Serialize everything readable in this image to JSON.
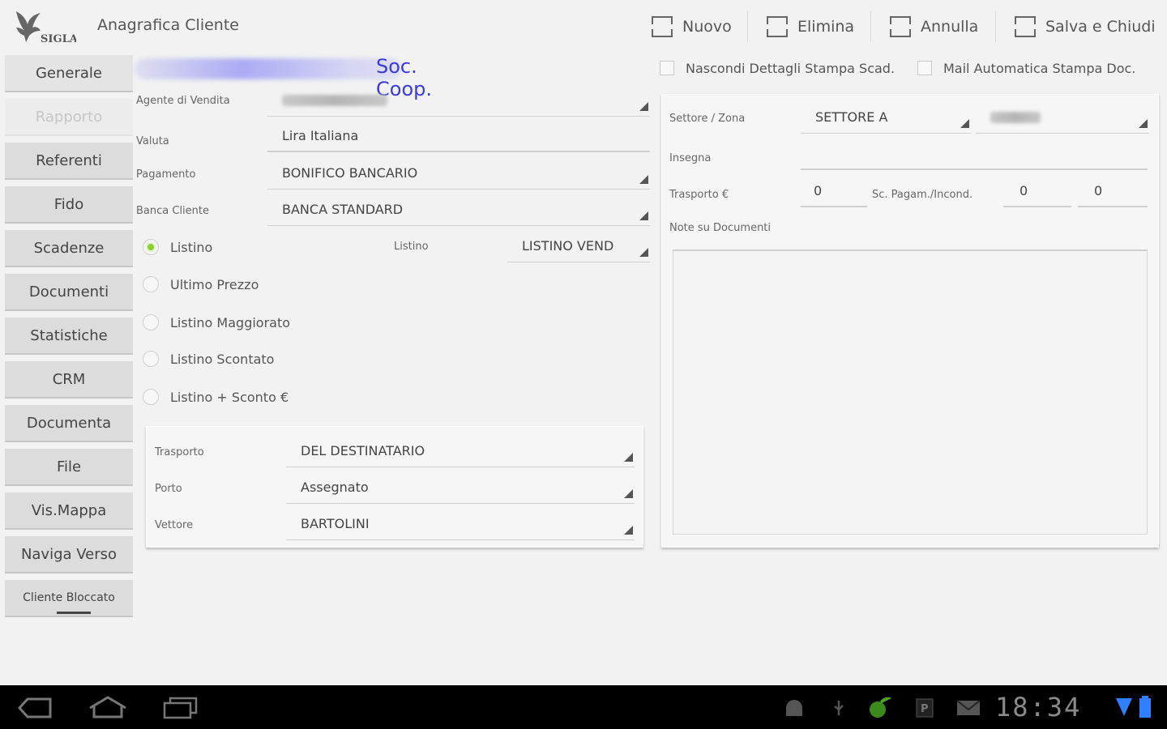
{
  "actionbar": {
    "title": "Anagrafica Cliente",
    "actions": [
      {
        "label": "Nuovo"
      },
      {
        "label": "Elimina"
      },
      {
        "label": "Annulla"
      },
      {
        "label": "Salva e Chiudi"
      }
    ]
  },
  "sidebar": {
    "items": [
      {
        "label": "Generale",
        "state": "selected"
      },
      {
        "label": "Rapporto",
        "state": "disabled"
      },
      {
        "label": "Referenti"
      },
      {
        "label": "Fido"
      },
      {
        "label": "Scadenze"
      },
      {
        "label": "Documenti"
      },
      {
        "label": "Statistiche"
      },
      {
        "label": "CRM"
      },
      {
        "label": "Documenta"
      },
      {
        "label": "File"
      },
      {
        "label": "Vis.Mappa"
      },
      {
        "label": "Naviga Verso"
      },
      {
        "label": "Cliente Bloccato"
      }
    ]
  },
  "client": {
    "name_suffix": "Soc. Coop."
  },
  "options": {
    "hide_print_details": {
      "label": "Nascondi Dettagli Stampa Scad.",
      "checked": false
    },
    "auto_mail": {
      "label": "Mail Automatica Stampa Doc.",
      "checked": false
    }
  },
  "left_form": {
    "agent": {
      "label": "Agente di Vendita",
      "value": "CUOMO EMILIO"
    },
    "currency": {
      "label": "Valuta",
      "value": "Lira Italiana"
    },
    "payment": {
      "label": "Pagamento",
      "value": "BONIFICO BANCARIO"
    },
    "bank": {
      "label": "Banca Cliente",
      "value": "BANCA STANDARD"
    },
    "pricing": {
      "options": [
        {
          "label": "Listino",
          "selected": true
        },
        {
          "label": "Ultimo Prezzo",
          "selected": false
        },
        {
          "label": "Listino Maggiorato",
          "selected": false
        },
        {
          "label": "Listino Scontato",
          "selected": false
        },
        {
          "label": "Listino + Sconto €",
          "selected": false
        }
      ],
      "list_label": "Listino",
      "list_value": "LISTINO VEND"
    }
  },
  "shipping": {
    "transport": {
      "label": "Trasporto",
      "value": "DEL DESTINATARIO"
    },
    "port": {
      "label": "Porto",
      "value": "Assegnato"
    },
    "carrier": {
      "label": "Vettore",
      "value": "BARTOLINI"
    }
  },
  "right_form": {
    "sector": {
      "label": "Settore / Zona",
      "value": "SETTORE A",
      "zone_value": "VARI"
    },
    "sign": {
      "label": "Insegna",
      "value": ""
    },
    "transport_cost": {
      "label": "Trasporto €",
      "value": "0"
    },
    "discount": {
      "label": "Sc. Pagam./Incond.",
      "value1": "0",
      "value2": "0"
    },
    "notes": {
      "label": "Note su Documenti",
      "value": ""
    }
  },
  "system": {
    "time": "18:34",
    "colors": {
      "accent_radio": "#8ad12e",
      "battery": "#2f7fff",
      "bar": "#000000"
    }
  }
}
